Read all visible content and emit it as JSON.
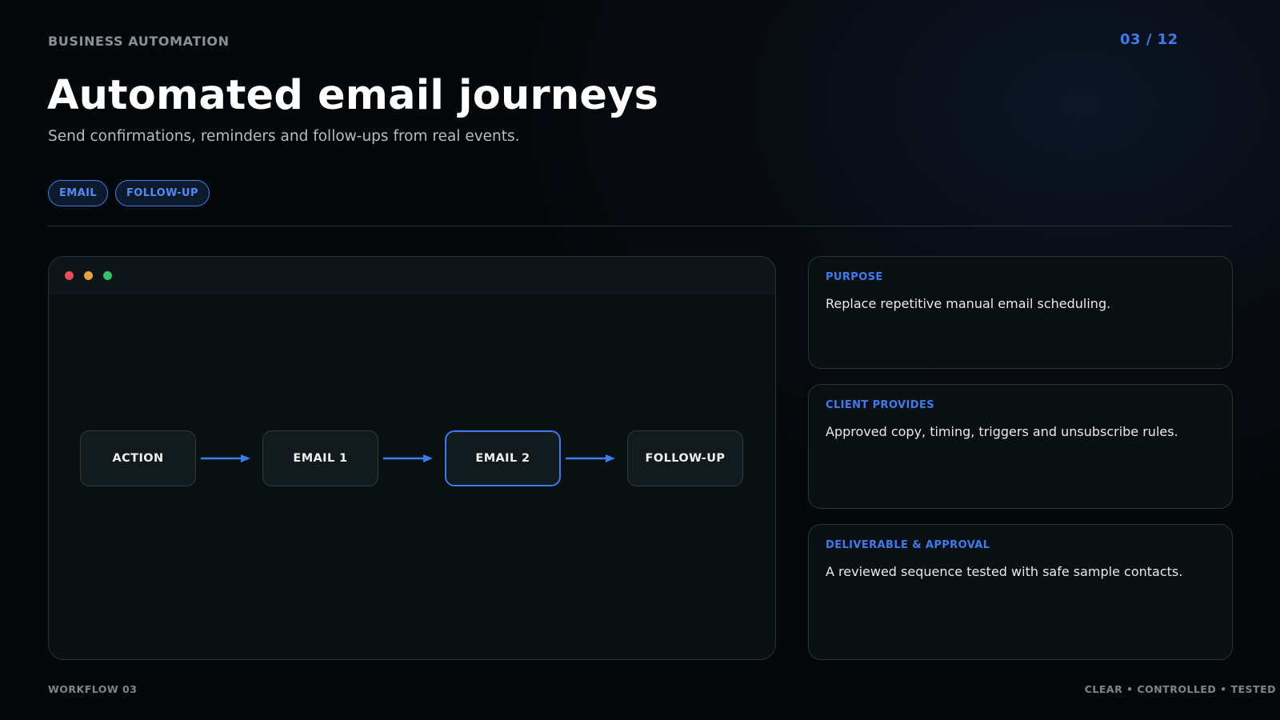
{
  "header": {
    "eyebrow": "BUSINESS AUTOMATION",
    "page_counter": "03 / 12",
    "title": "Automated email journeys",
    "subtitle": "Send confirmations, reminders and follow-ups from real events."
  },
  "tags": [
    "EMAIL",
    "FOLLOW-UP"
  ],
  "workflow": {
    "nodes": [
      {
        "label": "ACTION",
        "active": false
      },
      {
        "label": "EMAIL 1",
        "active": false
      },
      {
        "label": "EMAIL 2",
        "active": true
      },
      {
        "label": "FOLLOW-UP",
        "active": false
      }
    ]
  },
  "cards": [
    {
      "label": "PURPOSE",
      "text": "Replace repetitive manual email scheduling."
    },
    {
      "label": "CLIENT PROVIDES",
      "text": "Approved copy, timing, triggers and unsubscribe rules."
    },
    {
      "label": "DELIVERABLE & APPROVAL",
      "text": "A reviewed sequence tested with safe sample contacts."
    }
  ],
  "footer": {
    "left": "WORKFLOW 03",
    "right": "CLEAR • CONTROLLED • TESTED"
  },
  "colors": {
    "accent": "#3b7cf0",
    "dot_red": "#e54e52",
    "dot_yellow": "#e6a33a",
    "dot_green": "#2fc36f"
  }
}
